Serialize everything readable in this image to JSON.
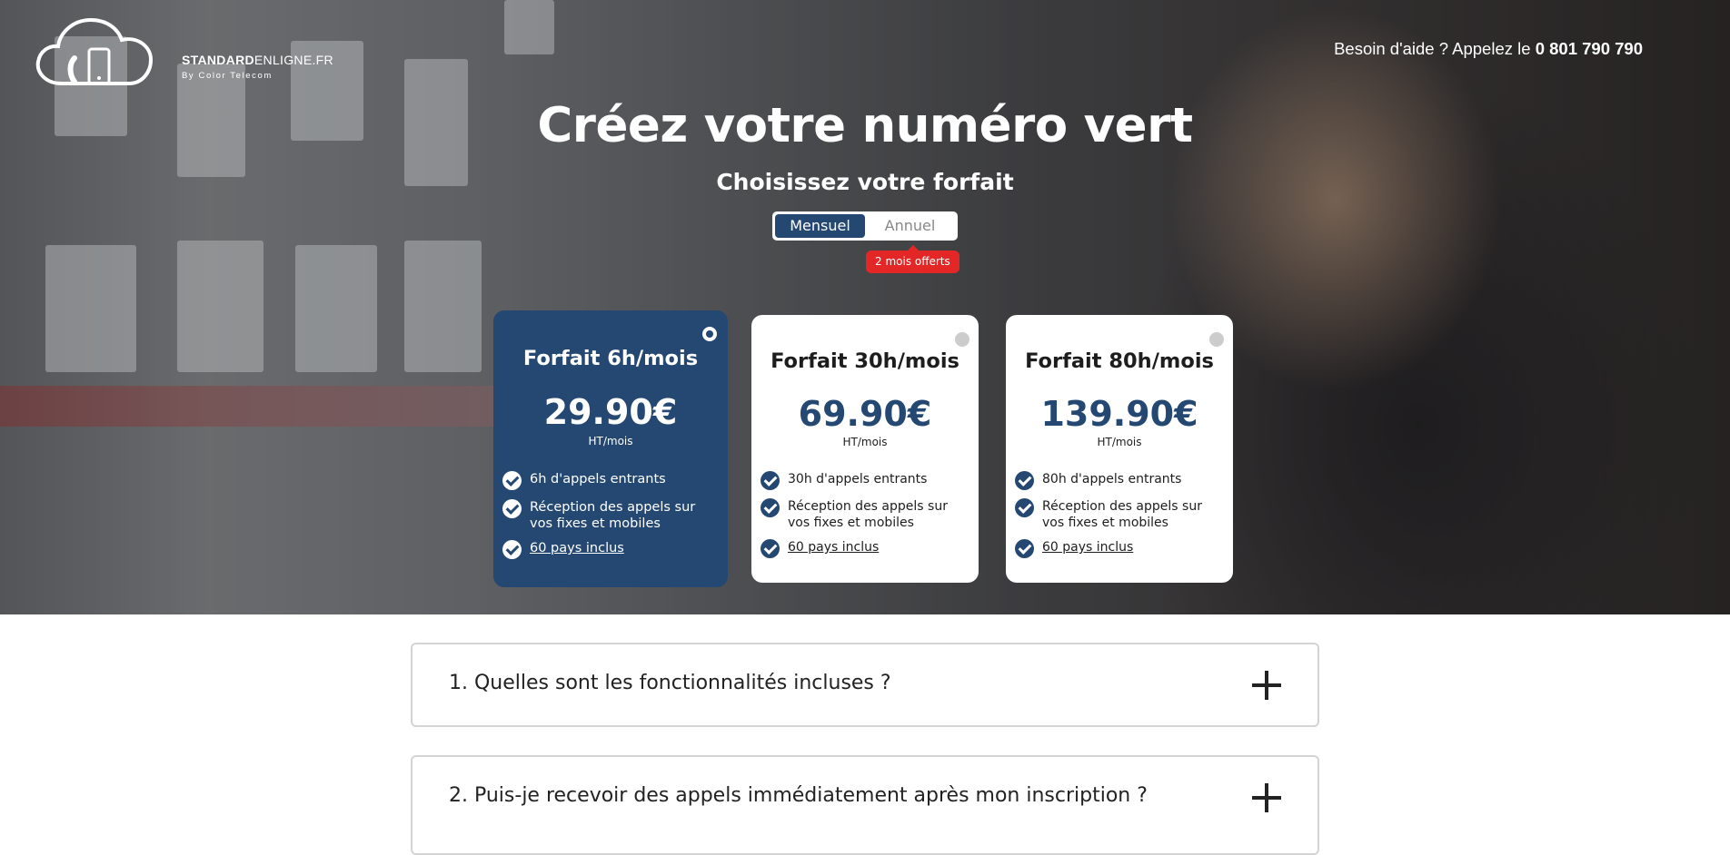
{
  "header": {
    "logo_main_bold": "STANDARD",
    "logo_main_light": "ENLIGNE.FR",
    "logo_sub": "By Color Telecom",
    "help_text": "Besoin d'aide ? Appelez le ",
    "help_phone": "0 801 790 790"
  },
  "hero": {
    "title": "Créez votre numéro vert",
    "subtitle": "Choisissez votre forfait"
  },
  "billing_toggle": {
    "options": [
      "Mensuel",
      "Annuel"
    ],
    "selected": "Mensuel",
    "promo_badge": "2 mois offerts"
  },
  "plans": [
    {
      "name": "Forfait 6h/mois",
      "price": "29.90€",
      "unit": "HT/mois",
      "selected": true,
      "features": [
        "6h d'appels entrants",
        "Réception des appels sur vos fixes et mobiles",
        "60 pays inclus"
      ]
    },
    {
      "name": "Forfait 30h/mois",
      "price": "69.90€",
      "unit": "HT/mois",
      "selected": false,
      "features": [
        "30h d'appels entrants",
        "Réception des appels sur vos fixes et mobiles",
        "60 pays inclus"
      ]
    },
    {
      "name": "Forfait 80h/mois",
      "price": "139.90€",
      "unit": "HT/mois",
      "selected": false,
      "features": [
        "80h d'appels entrants",
        "Réception des appels sur vos fixes et mobiles",
        "60 pays inclus"
      ]
    }
  ],
  "faq": [
    {
      "question": "1. Quelles sont les fonctionnalités incluses ?"
    },
    {
      "question": "2. Puis-je recevoir des appels immédiatement après mon inscription ?"
    }
  ],
  "colors": {
    "brand_navy": "#244871",
    "promo_red": "#e32626"
  }
}
